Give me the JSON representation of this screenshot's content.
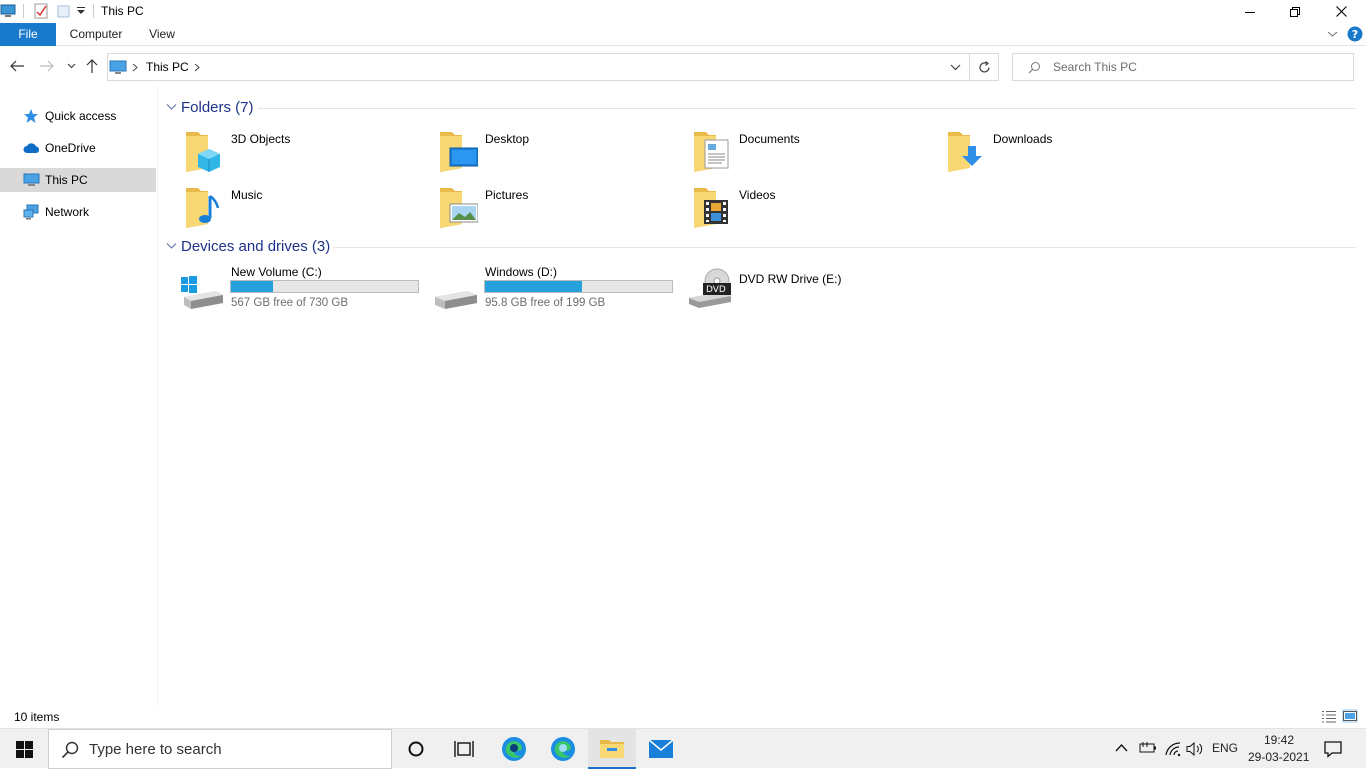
{
  "window": {
    "title": "This PC"
  },
  "ribbon": {
    "tabs": [
      "File",
      "Computer",
      "View"
    ]
  },
  "address": {
    "location": "This PC"
  },
  "search": {
    "placeholder": "Search This PC"
  },
  "sidebar": {
    "items": [
      {
        "label": "Quick access",
        "icon": "star-icon"
      },
      {
        "label": "OneDrive",
        "icon": "cloud-icon"
      },
      {
        "label": "This PC",
        "icon": "computer-icon",
        "selected": true
      },
      {
        "label": "Network",
        "icon": "network-icon"
      }
    ]
  },
  "folders": {
    "heading": "Folders (7)",
    "items": [
      "3D Objects",
      "Desktop",
      "Documents",
      "Downloads",
      "Music",
      "Pictures",
      "Videos"
    ]
  },
  "drives": {
    "heading": "Devices and drives (3)",
    "items": [
      {
        "label": "New Volume (C:)",
        "free": "567 GB free of 730 GB",
        "used_fraction": 0.223
      },
      {
        "label": "Windows (D:)",
        "free": "95.8 GB free of 199 GB",
        "used_fraction": 0.519
      },
      {
        "label": "DVD RW Drive (E:)",
        "badge": "DVD"
      }
    ]
  },
  "status": {
    "items_count": "10 items"
  },
  "taskbar": {
    "search_placeholder": "Type here to search",
    "language": "ENG",
    "time": "19:42",
    "date": "29-03-2021"
  },
  "colors": {
    "accent": "#1979ca",
    "progress": "#26a0da",
    "group_heading": "#1e3287",
    "folder": "#f8d775",
    "selected_nav": "#d9d9d9"
  }
}
